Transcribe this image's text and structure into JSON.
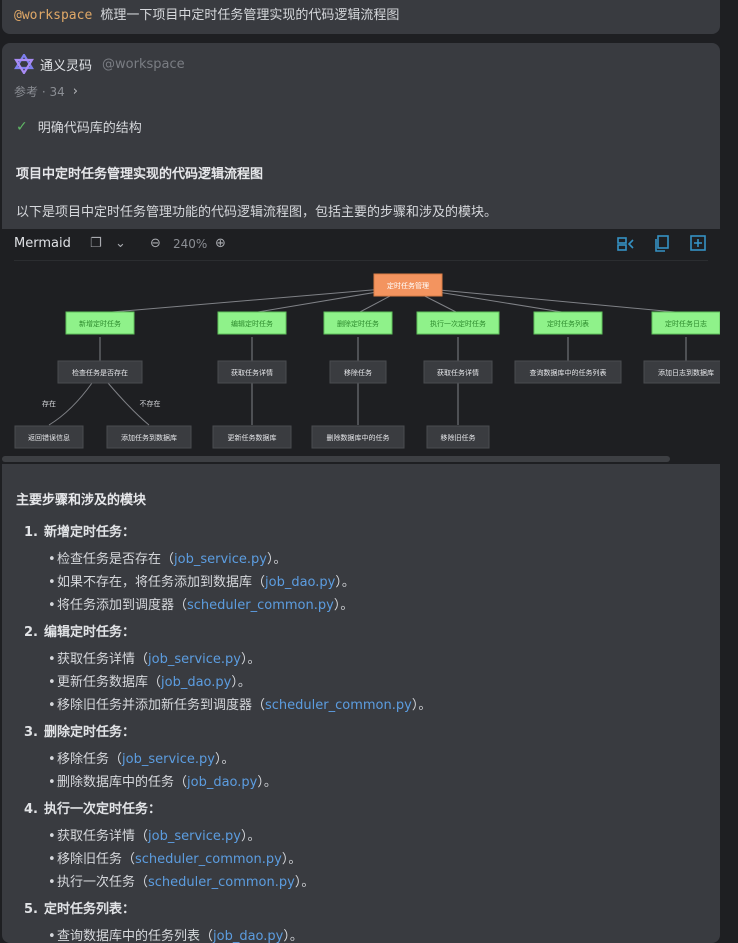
{
  "user": {
    "mention": "@workspace",
    "message": "梳理一下项目中定时任务管理实现的代码逻辑流程图"
  },
  "assistant": {
    "name": "通义灵码",
    "workspace": "@workspace",
    "refs": "参考 · 34",
    "step": "明确代码库的结构",
    "title": "项目中定时任务管理实现的代码逻辑流程图",
    "intro": "以下是项目中定时任务管理功能的代码逻辑流程图，包括主要的步骤和涉及的模块。"
  },
  "mermaid": {
    "label": "Mermaid",
    "zoom": "240%",
    "root": "定时任务管理",
    "level1": [
      "新增定时任务",
      "编辑定时任务",
      "删除定时任务",
      "执行一次定时任务",
      "定时任务列表",
      "定时任务日志"
    ],
    "level2": [
      "检查任务是否存在",
      "获取任务详情",
      "移除任务",
      "获取任务详情",
      "查询数据库中的任务列表",
      "添加日志到数据库"
    ],
    "edge_labels": [
      "存在",
      "不存在"
    ],
    "level3": [
      "返回错误信息",
      "添加任务到数据库",
      "更新任务数据库",
      "删除数据库中的任务",
      "移除旧任务"
    ]
  },
  "steps_title": "主要步骤和涉及的模块",
  "sections": [
    {
      "num": "1.",
      "title": "新增定时任务：",
      "items": [
        {
          "pre": "检查任务是否存在（",
          "code": "job_service.py",
          "post": "）。"
        },
        {
          "pre": "如果不存在，将任务添加到数据库（",
          "code": "job_dao.py",
          "post": "）。"
        },
        {
          "pre": "将任务添加到调度器（",
          "code": "scheduler_common.py",
          "post": "）。"
        }
      ]
    },
    {
      "num": "2.",
      "title": "编辑定时任务：",
      "items": [
        {
          "pre": "获取任务详情（",
          "code": "job_service.py",
          "post": "）。"
        },
        {
          "pre": "更新任务数据库（",
          "code": "job_dao.py",
          "post": "）。"
        },
        {
          "pre": "移除旧任务并添加新任务到调度器（",
          "code": "scheduler_common.py",
          "post": "）。"
        }
      ]
    },
    {
      "num": "3.",
      "title": "删除定时任务：",
      "items": [
        {
          "pre": "移除任务（",
          "code": "job_service.py",
          "post": "）。"
        },
        {
          "pre": "删除数据库中的任务（",
          "code": "job_dao.py",
          "post": "）。"
        }
      ]
    },
    {
      "num": "4.",
      "title": "执行一次定时任务：",
      "items": [
        {
          "pre": "获取任务详情（",
          "code": "job_service.py",
          "post": "）。"
        },
        {
          "pre": "移除旧任务（",
          "code": "scheduler_common.py",
          "post": "）。"
        },
        {
          "pre": "执行一次任务（",
          "code": "scheduler_common.py",
          "post": "）。"
        }
      ]
    },
    {
      "num": "5.",
      "title": "定时任务列表：",
      "items": [
        {
          "pre": "查询数据库中的任务列表（",
          "code": "job_dao.py",
          "post": "）。"
        }
      ]
    }
  ],
  "colors": {
    "root_fill": "#f3945f",
    "level1_fill": "#8ff28a",
    "node_fill": "#3a3c40",
    "link": "#5c9de0",
    "check": "#5fb865"
  }
}
